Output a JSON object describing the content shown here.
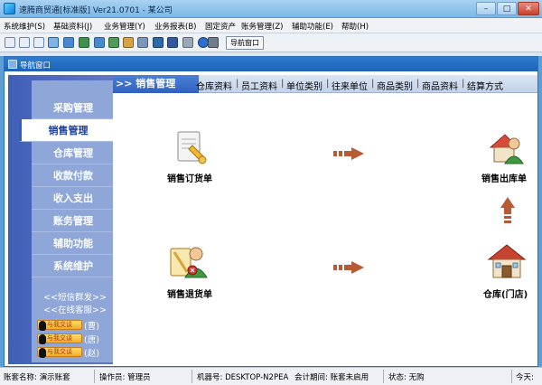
{
  "window": {
    "title": "速腾商贸通[标准版] Ver21.0701 - 某公司",
    "minimize": "–",
    "maximize": "□",
    "close": "✕"
  },
  "menu": [
    "系统维护(S)",
    "基础资料(J)",
    "业务管理(Y)",
    "业务报表(B)",
    "固定资产",
    "账务管理(Z)",
    "辅助功能(E)",
    "帮助(H)"
  ],
  "toolbar": {
    "nav_button": "导航窗口",
    "icons": [
      "doc-icon",
      "doc-icon",
      "doc-icon",
      "monitor-icon",
      "user-icon",
      "user-icon",
      "user-icon",
      "user-icon",
      "card-icon",
      "stack-icon",
      "mail-icon",
      "save-icon",
      "print-icon",
      "help-icon",
      "exit-icon"
    ]
  },
  "panel": {
    "title": "导航窗口"
  },
  "sidebar": {
    "items": [
      "采购管理",
      "销售管理",
      "仓库管理",
      "收款付款",
      "收入支出",
      "账务管理",
      "辅助功能",
      "系统维护"
    ],
    "active": "销售管理",
    "links": [
      "<<短信群发>>",
      "<<在线客服>>"
    ],
    "qq_badge": "与我交谈",
    "qq_contacts": [
      "(曹)",
      "(唐)",
      "(赵)"
    ]
  },
  "section": {
    "title": ">> 销售管理",
    "tabs": [
      "仓库资料",
      "员工资料",
      "单位类别",
      "往来单位",
      "商品类别",
      "商品资料",
      "结算方式"
    ],
    "separator": "|"
  },
  "flow": {
    "order": "销售订货单",
    "outbound": "销售出库单",
    "return": "销售退货单",
    "warehouse": "仓库(门店)"
  },
  "status": {
    "account": "账套名称: 演示账套",
    "operator": "操作员: 管理员",
    "machine": "机器号: DESKTOP-N2PEA",
    "period": "会计期间: 账套未启用",
    "state": "状态: 无购",
    "today": "今天:"
  },
  "colors": {
    "sidebar": "#5a73c2",
    "accent": "#2f62bd",
    "arrow": "#b85a33"
  }
}
